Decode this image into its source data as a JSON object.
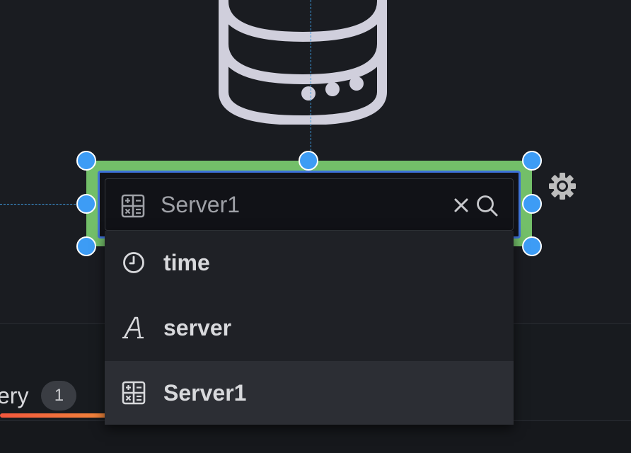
{
  "search": {
    "value": "Server1",
    "placeholder": "Server1"
  },
  "dropdown": {
    "items": [
      {
        "label": "time",
        "icon": "clock-icon"
      },
      {
        "label": "server",
        "icon": "text-field-icon"
      },
      {
        "label": "Server1",
        "icon": "calculator-field-icon"
      }
    ],
    "selected_index": 2
  },
  "query_tab": {
    "label": "ery",
    "count": "1"
  },
  "colors": {
    "background": "#1a1c21",
    "selection_frame": "#73bf69",
    "inner_border": "#3d71d9",
    "handle": "#3d9cf5",
    "guide": "#3d9be0",
    "tab_active": "#f4573d"
  }
}
